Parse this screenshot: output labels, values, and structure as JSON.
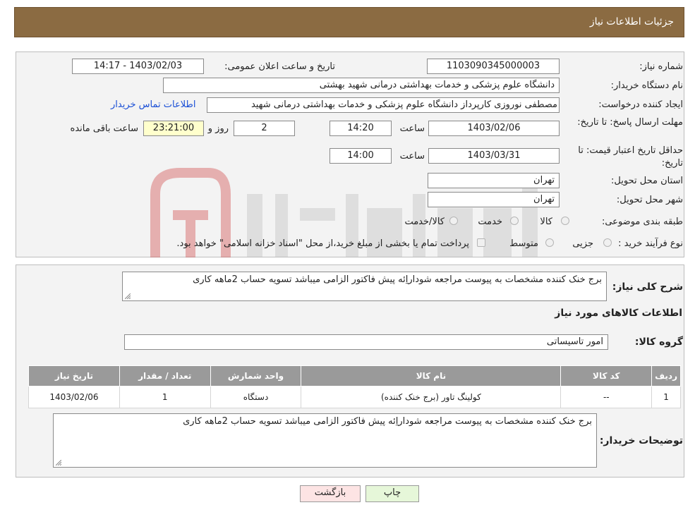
{
  "header": {
    "title": "جزئیات اطلاعات نیاز"
  },
  "form": {
    "need_number_label": "شماره نیاز:",
    "need_number": "1103090345000003",
    "announce_label": "تاریخ و ساعت اعلان عمومی:",
    "announce_value": "1403/02/03 - 14:17",
    "buyer_org_label": "نام دستگاه خریدار:",
    "buyer_org": "دانشگاه علوم پزشکی و خدمات بهداشتی درمانی شهید بهشتی",
    "creator_label": "ایجاد کننده درخواست:",
    "creator": "مصطفی نوروزی کارپرداز دانشگاه علوم پزشکی و خدمات بهداشتی درمانی شهید",
    "contact_link": "اطلاعات تماس خریدار",
    "deadline_label": "مهلت ارسال پاسخ: تا تاریخ:",
    "deadline_date": "1403/02/06",
    "time_label": "ساعت",
    "deadline_time": "14:20",
    "days_value": "2",
    "days_label": "روز و",
    "remaining_time": "23:21:00",
    "remaining_label": "ساعت باقی مانده",
    "validity_label": "حداقل تاریخ اعتبار قیمت: تا تاریخ:",
    "validity_date": "1403/03/31",
    "validity_time": "14:00",
    "province_label": "استان محل تحویل:",
    "province": "تهران",
    "city_label": "شهر محل تحویل:",
    "city": "تهران",
    "category_label": "طبقه بندی موضوعی:",
    "category_options": [
      "کالا",
      "خدمت",
      "کالا/خدمت"
    ],
    "process_label": "نوع فرآیند خرید :",
    "process_options": [
      "جزیی",
      "متوسط"
    ],
    "process_note": "پرداخت تمام یا بخشی از مبلغ خرید،از محل \"اسناد خزانه اسلامی\" خواهد بود."
  },
  "details": {
    "description_label": "شرح کلی نیاز:",
    "description": "برج خنک کننده مشخصات به پیوست مراجعه شوداراِئه پیش فاکتور الزامی میباشد تسویه حساب 2ماهه کاری",
    "items_title": "اطلاعات کالاهای مورد نیاز",
    "group_label": "گروه کالا:",
    "group_value": "امور تاسیساتی",
    "table": {
      "headers": [
        "ردیف",
        "کد کالا",
        "نام کالا",
        "واحد شمارش",
        "تعداد / مقدار",
        "تاریخ نیاز"
      ],
      "rows": [
        [
          "1",
          "--",
          "کولینگ تاور (برج خنک کننده)",
          "دستگاه",
          "1",
          "1403/02/06"
        ]
      ]
    },
    "buyer_notes_label": "توضیحات خریدار:",
    "buyer_notes": "برج خنک کننده مشخصات به پیوست مراجعه شوداراِئه پیش فاکتور الزامی میباشد تسویه حساب 2ماهه کاری"
  },
  "buttons": {
    "print": "چاپ",
    "back": "بازگشت"
  },
  "colors": {
    "header": "#8b6b42",
    "link": "#1a4fd6",
    "back_button": "#fde4e4",
    "print_button": "#e6f7d9"
  }
}
